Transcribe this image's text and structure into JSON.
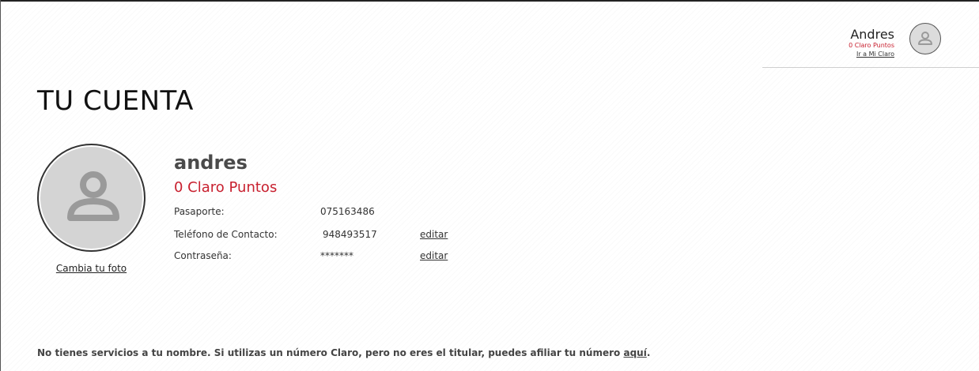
{
  "header": {
    "user_name": "Andres",
    "user_points": "0 Claro Puntos",
    "user_link": "Ir a Mi Claro"
  },
  "page": {
    "title": "TU CUENTA"
  },
  "profile": {
    "change_photo": "Cambia tu foto",
    "name": "andres",
    "points": "0 Claro Puntos",
    "rows": [
      {
        "label": "Pasaporte:",
        "value": "075163486",
        "edit": ""
      },
      {
        "label": "Teléfono de Contacto:",
        "value": "948493517",
        "edit": "editar"
      },
      {
        "label": "Contraseña:",
        "value": "*******",
        "edit": "editar"
      }
    ]
  },
  "footer": {
    "note": "No tienes servicios a tu nombre. Si utilizas un número Claro, pero no eres el titular, puedes afiliar tu número ",
    "link": "aquí",
    "note_end": "."
  },
  "colors": {
    "brand_red": "#c8202f",
    "avatar_bg": "#d4d4d4",
    "avatar_icon": "#9a9a9a"
  },
  "icons": {
    "avatar": "user-silhouette-icon"
  }
}
